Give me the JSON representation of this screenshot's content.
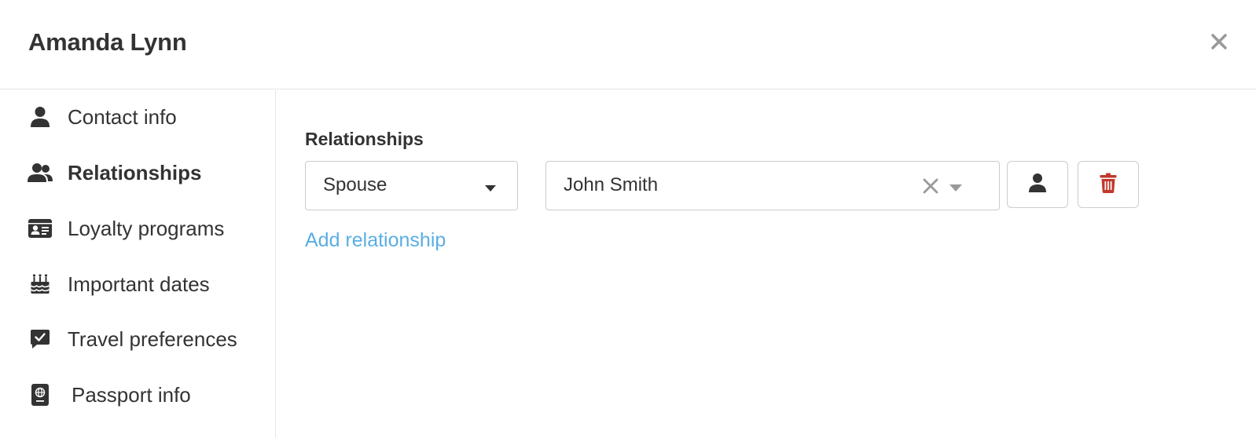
{
  "modal": {
    "title": "Amanda Lynn",
    "close_icon": "close-icon"
  },
  "sidebar": {
    "items": [
      {
        "label": "Contact info",
        "icon": "user-icon",
        "active": false
      },
      {
        "label": "Relationships",
        "icon": "users-icon",
        "active": true
      },
      {
        "label": "Loyalty programs",
        "icon": "id-card-icon",
        "active": false
      },
      {
        "label": "Important dates",
        "icon": "birthday-cake-icon",
        "active": false
      },
      {
        "label": "Travel preferences",
        "icon": "comment-check-icon",
        "active": false
      },
      {
        "label": "Passport info",
        "icon": "passport-icon",
        "active": false
      }
    ]
  },
  "main": {
    "section_label": "Relationships",
    "relationship": {
      "type_value": "Spouse",
      "person_value": "John Smith"
    },
    "add_link": "Add relationship"
  },
  "colors": {
    "text": "#333333",
    "link": "#5aaee3",
    "delete": "#c0392b",
    "border": "#cccccc",
    "icon_muted": "#999999"
  }
}
